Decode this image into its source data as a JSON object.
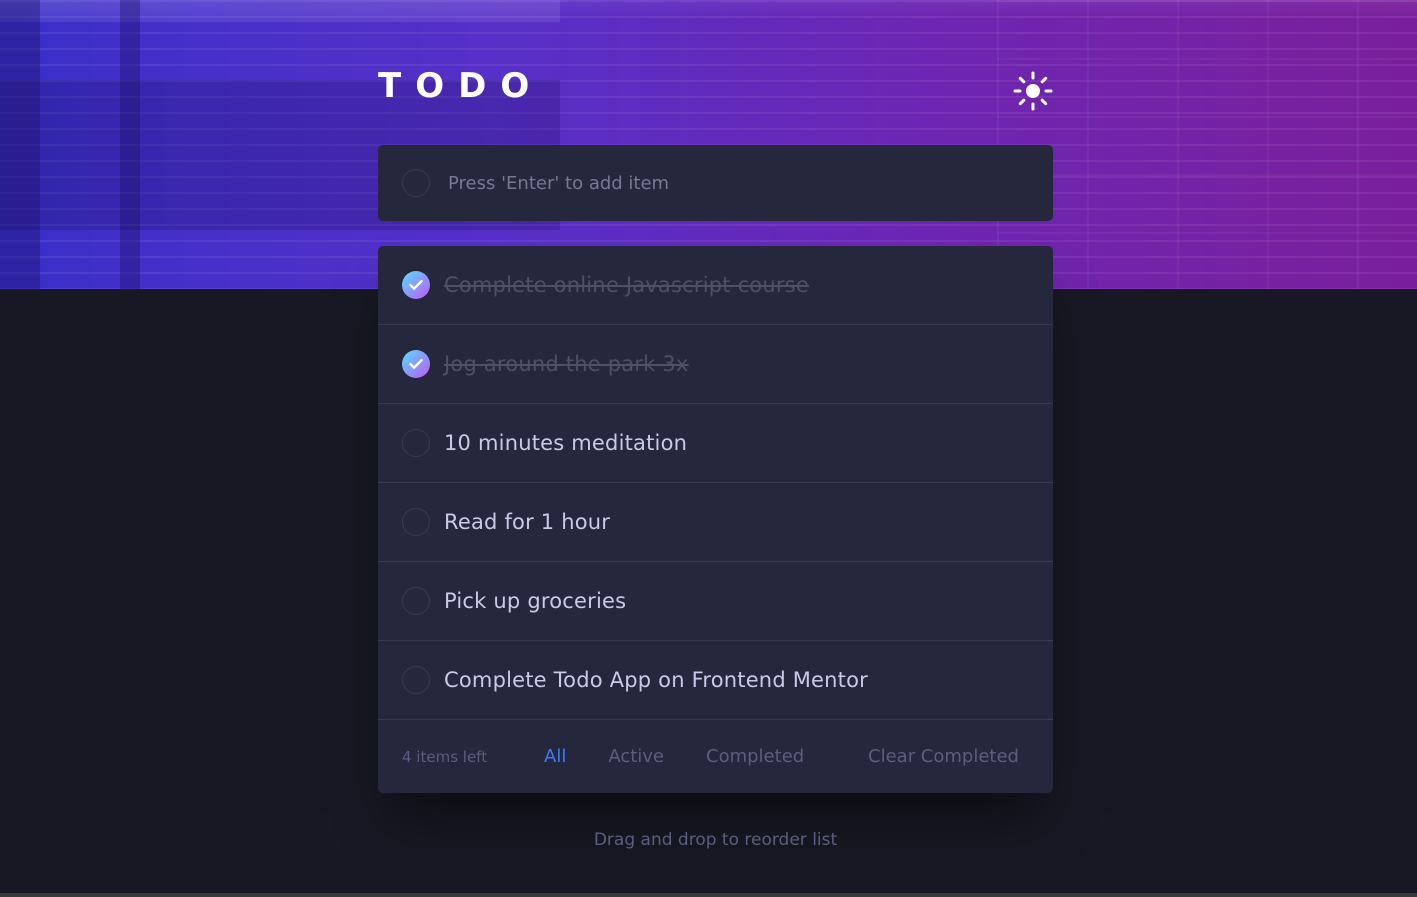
{
  "app": {
    "title": "TODO"
  },
  "theme_toggle": {
    "icon": "sun-icon"
  },
  "new_todo": {
    "placeholder": "Press 'Enter' to add item",
    "value": ""
  },
  "todos": [
    {
      "text": "Complete online Javascript course",
      "completed": true
    },
    {
      "text": "Jog around the park 3x",
      "completed": true
    },
    {
      "text": "10 minutes meditation",
      "completed": false
    },
    {
      "text": "Read for 1 hour",
      "completed": false
    },
    {
      "text": "Pick up groceries",
      "completed": false
    },
    {
      "text": "Complete Todo App on Frontend Mentor",
      "completed": false
    }
  ],
  "footer": {
    "items_left": "4 items left",
    "filters": [
      "All",
      "Active",
      "Completed"
    ],
    "active_filter": "All",
    "clear_label": "Clear Completed"
  },
  "hint": "Drag and drop to reorder list",
  "colors": {
    "accent": "#3a7cfd",
    "check_gradient_start": "#55ddff",
    "check_gradient_end": "#c058f3",
    "panel": "#25273d",
    "background": "#171823"
  }
}
